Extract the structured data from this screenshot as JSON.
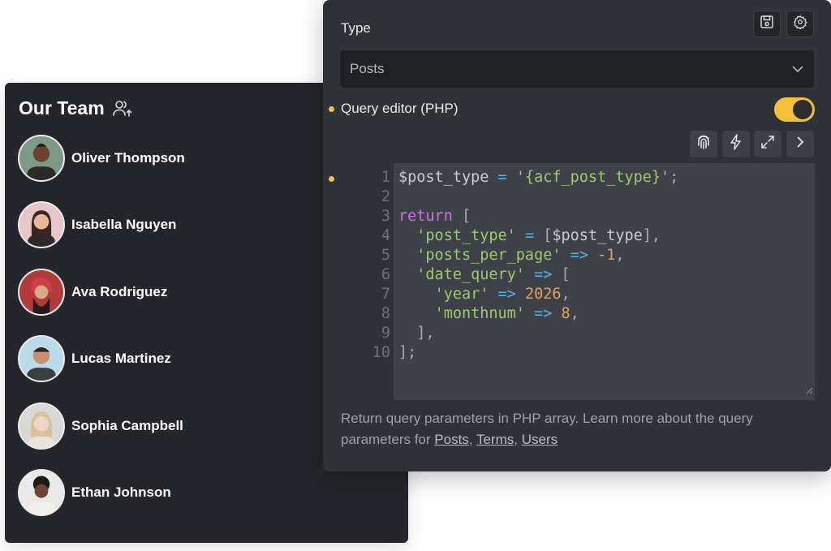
{
  "team": {
    "title": "Our Team",
    "members": [
      {
        "name": "Oliver Thompson"
      },
      {
        "name": "Isabella Nguyen"
      },
      {
        "name": "Ava Rodriguez"
      },
      {
        "name": "Lucas Martinez"
      },
      {
        "name": "Sophia Campbell"
      },
      {
        "name": "Ethan Johnson"
      }
    ]
  },
  "panel": {
    "type_label": "Type",
    "type_value": "Posts",
    "query_editor_label": "Query editor (PHP)",
    "toggle_on": true,
    "code_lines": [
      {
        "n": "1",
        "text": "$post_type = '{acf_post_type}';"
      },
      {
        "n": "2",
        "text": ""
      },
      {
        "n": "3",
        "text": "return ["
      },
      {
        "n": "4",
        "text": "  'post_type' = [$post_type],"
      },
      {
        "n": "5",
        "text": "  'posts_per_page' => -1,"
      },
      {
        "n": "6",
        "text": "  'date_query' => ["
      },
      {
        "n": "7",
        "text": "    'year' => 2026,"
      },
      {
        "n": "8",
        "text": "    'monthnum' => 8,"
      },
      {
        "n": "9",
        "text": "  ],"
      },
      {
        "n": "10",
        "text": "];"
      }
    ],
    "help_text": "Return query parameters in PHP array. Learn more about the query parameters for",
    "links": {
      "posts": "Posts",
      "terms": "Terms",
      "users": "Users"
    },
    "sep1": ",",
    "sep2": ","
  },
  "colors": {
    "accent": "#f4c038",
    "panel_bg": "#2f3237",
    "team_bg": "#25262b"
  }
}
